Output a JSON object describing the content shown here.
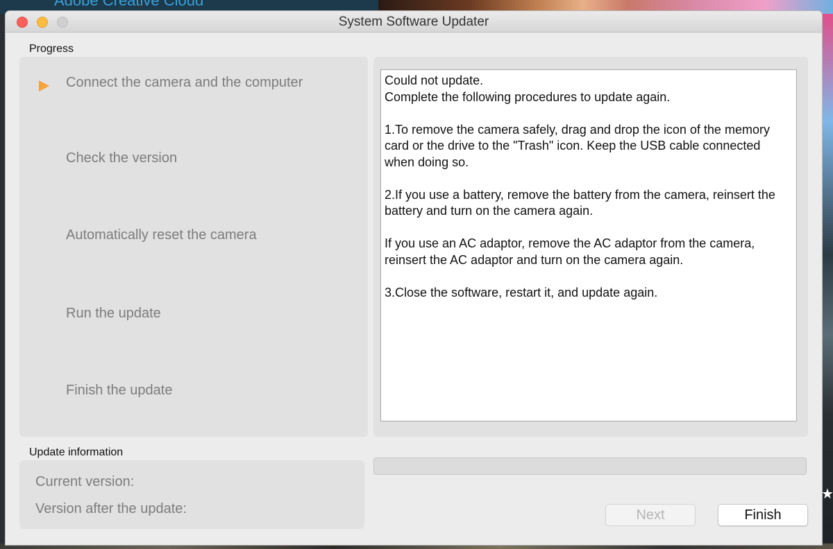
{
  "background": {
    "partial_text": "Adobe Creative Cloud"
  },
  "window": {
    "title": "System Software Updater"
  },
  "progress": {
    "label": "Progress",
    "steps": [
      "Connect the camera and the computer",
      "Check the version",
      "Automatically reset the camera",
      "Run the update",
      "Finish the update"
    ],
    "active_step": 0
  },
  "message": {
    "lines": [
      "Could not update.",
      "Complete the following procedures to update again.",
      "1.To remove the camera safely, drag and drop the icon of the memory card or the drive to the \"Trash\" icon. Keep the USB cable connected when doing so.",
      "2.If you use a battery, remove the battery from the camera, reinsert the battery and turn on the camera again.",
      "If you use an AC adaptor, remove the AC adaptor from the camera, reinsert the AC adaptor and turn on the camera again.",
      "3.Close the software, restart it, and update again."
    ]
  },
  "update_info": {
    "label": "Update information",
    "current_version_label": "Current version:",
    "after_version_label": "Version after the update:"
  },
  "progress_bar": {
    "fraction": 0
  },
  "buttons": {
    "next": "Next",
    "finish": "Finish"
  },
  "colors": {
    "active_arrow": "#f5a33a",
    "close": "#fc605b",
    "minimize": "#fdbc40"
  }
}
